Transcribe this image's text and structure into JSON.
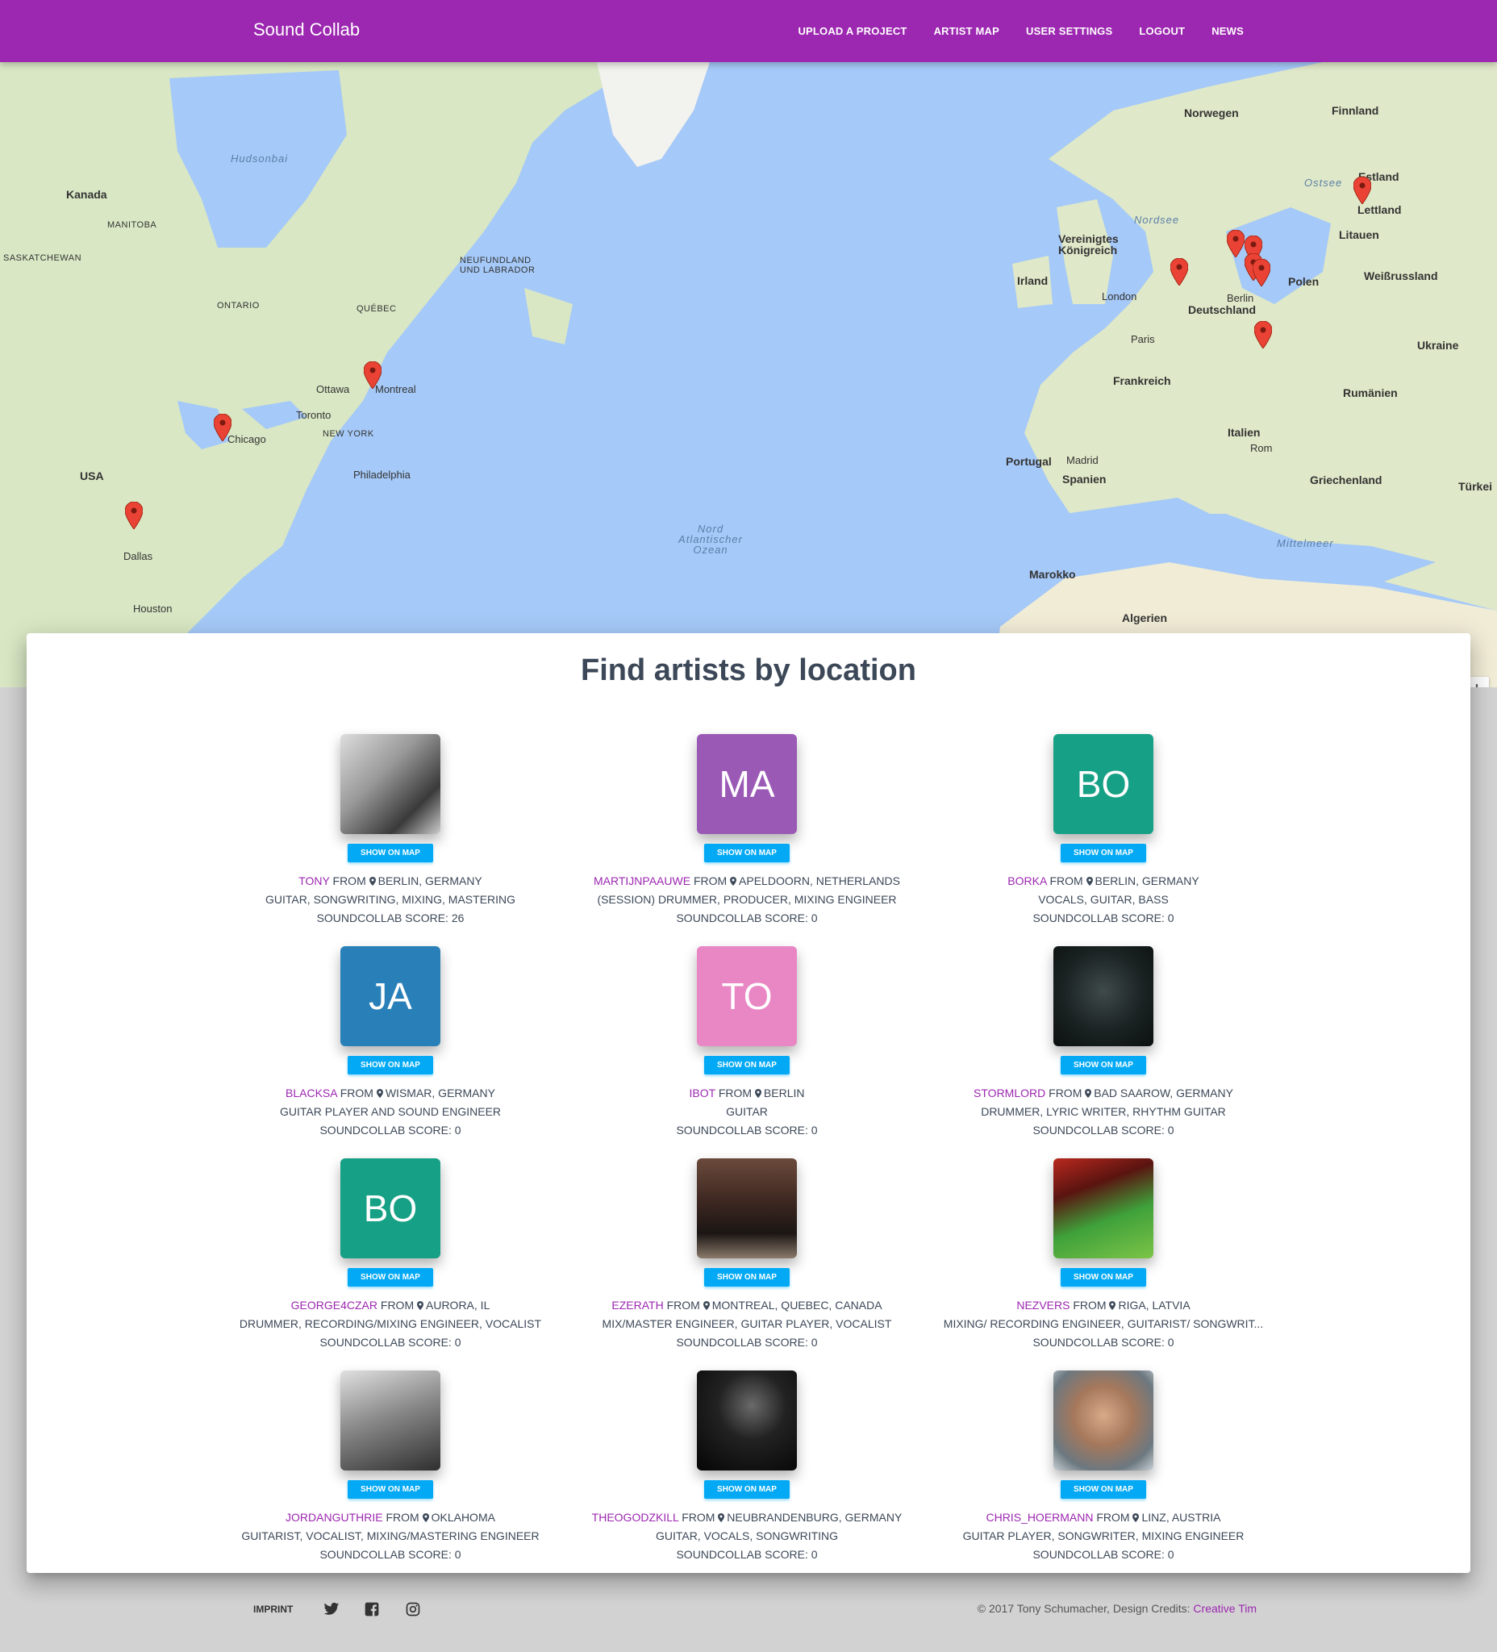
{
  "nav": {
    "brand": "Sound Collab",
    "links": [
      "UPLOAD A PROJECT",
      "ARTIST MAP",
      "USER SETTINGS",
      "LOGOUT",
      "NEWS"
    ]
  },
  "map": {
    "labels": {
      "hudsonbai": "Hudsonbai",
      "kanada": "Kanada",
      "manitoba": "MANITOBA",
      "saskatchewan": "SASKATCHEWAN",
      "ontario": "ONTARIO",
      "quebec": "QUÉBEC",
      "neufundland": "NEUFUNDLAND UND LABRADOR",
      "nordsee": "Nordsee",
      "norwegen": "Norwegen",
      "finnland": "Finnland",
      "ostsee": "Ostsee",
      "estland": "Estland",
      "lettland": "Lettland",
      "litauen": "Litauen",
      "irland": "Irland",
      "vk": "Vereinigtes Königreich",
      "polen": "Polen",
      "weissrussland": "Weißrussland",
      "deutschland": "Deutschland",
      "frankreich": "Frankreich",
      "ukraine": "Ukraine",
      "rumanien": "Rumänien",
      "italien": "Italien",
      "portugal": "Portugal",
      "spanien": "Spanien",
      "griechenland": "Griechenland",
      "turkei": "Türkei",
      "marokko": "Marokko",
      "algerien": "Algerien",
      "ozean": "Nord Atlantischer Ozean",
      "usa": "USA",
      "chicago": "Chicago",
      "montreal": "Montreal",
      "ottawa": "Ottawa",
      "toronto": "Toronto",
      "dallas": "Dallas",
      "houston": "Houston",
      "newyork": "NEW YORK",
      "philadelphia": "Philadelphia",
      "mittelmeer": "Mittelmeer",
      "london": "London",
      "paris": "Paris",
      "berlin": "Berlin",
      "madrid": "Madrid",
      "rom": "Rom"
    },
    "zoom_in": "+",
    "zoom_out": "−"
  },
  "main": {
    "title": "Find artists by location",
    "show_on_map": "SHOW ON MAP",
    "from_word": "FROM",
    "artists": [
      {
        "name": "TONY",
        "location": "BERLIN, GERMANY",
        "skills": "GUITAR, SONGWRITING, MIXING, MASTERING",
        "score": "SOUNDCOLLAB SCORE: 26",
        "initials": "",
        "color": "#7b7b7b",
        "photo": "gray"
      },
      {
        "name": "MARTIJNPAAUWE",
        "location": "APELDOORN, NETHERLANDS",
        "skills": "(SESSION) DRUMMER, PRODUCER, MIXING ENGINEER",
        "score": "SOUNDCOLLAB SCORE: 0",
        "initials": "MA",
        "color": "#9b59b6"
      },
      {
        "name": "BORKA",
        "location": "BERLIN, GERMANY",
        "skills": "VOCALS, GUITAR, BASS",
        "score": "SOUNDCOLLAB SCORE: 0",
        "initials": "BO",
        "color": "#16a085"
      },
      {
        "name": "BLACKSA",
        "location": "WISMAR, GERMANY",
        "skills": "GUITAR PLAYER AND SOUND ENGINEER",
        "score": "SOUNDCOLLAB SCORE: 0",
        "initials": "JA",
        "color": "#2980b9"
      },
      {
        "name": "IBOT",
        "location": "BERLIN",
        "skills": "GUITAR",
        "score": "SOUNDCOLLAB SCORE: 0",
        "initials": "TO",
        "color": "#e887c4"
      },
      {
        "name": "STORMLORD",
        "location": "BAD SAAROW, GERMANY",
        "skills": "DRUMMER, LYRIC WRITER, RHYTHM GUITAR",
        "score": "SOUNDCOLLAB SCORE: 0",
        "initials": "",
        "color": "#1e2a2a",
        "photo": "dark"
      },
      {
        "name": "GEORGE4CZAR",
        "location": "AURORA, IL",
        "skills": "DRUMMER, RECORDING/MIXING ENGINEER, VOCALIST",
        "score": "SOUNDCOLLAB SCORE: 0",
        "initials": "BO",
        "color": "#16a085"
      },
      {
        "name": "EZERATH",
        "location": "MONTREAL, QUEBEC, CANADA",
        "skills": "MIX/MASTER ENGINEER, GUITAR PLAYER, VOCALIST",
        "score": "SOUNDCOLLAB SCORE: 0",
        "initials": "",
        "color": "#3b2a28",
        "photo": "castle"
      },
      {
        "name": "NEZVERS",
        "location": "RIGA, LATVIA",
        "skills": "MIXING/ RECORDING ENGINEER, GUITARIST/ SONGWRIT...",
        "score": "SOUNDCOLLAB SCORE: 0",
        "initials": "",
        "color": "#c0392b",
        "photo": "green"
      },
      {
        "name": "JORDANGUTHRIE",
        "location": "OKLAHOMA",
        "skills": "GUITARIST, VOCALIST, MIXING/MASTERING ENGINEER",
        "score": "SOUNDCOLLAB SCORE: 0",
        "initials": "",
        "color": "#555",
        "photo": "bw"
      },
      {
        "name": "THEOGODZKILL",
        "location": "NEUBRANDENBURG, GERMANY",
        "skills": "GUITAR, VOCALS, SONGWRITING",
        "score": "SOUNDCOLLAB SCORE: 0",
        "initials": "",
        "color": "#111",
        "photo": "black"
      },
      {
        "name": "CHRIS_HOERMANN",
        "location": "LINZ, AUSTRIA",
        "skills": "GUITAR PLAYER, SONGWRITER, MIXING ENGINEER",
        "score": "SOUNDCOLLAB SCORE: 0",
        "initials": "",
        "color": "#a0785a",
        "photo": "portrait"
      }
    ]
  },
  "footer": {
    "imprint": "IMPRINT",
    "copyright": "© 2017 Tony Schumacher, Design Credits: ",
    "credit": "Creative Tim",
    "icons": [
      "twitter-icon",
      "facebook-icon",
      "instagram-icon"
    ]
  },
  "colors": {
    "primary": "#9c27b0",
    "info": "#03a9f4",
    "water": "#a5c9f8",
    "land": "#e9ebd4"
  }
}
